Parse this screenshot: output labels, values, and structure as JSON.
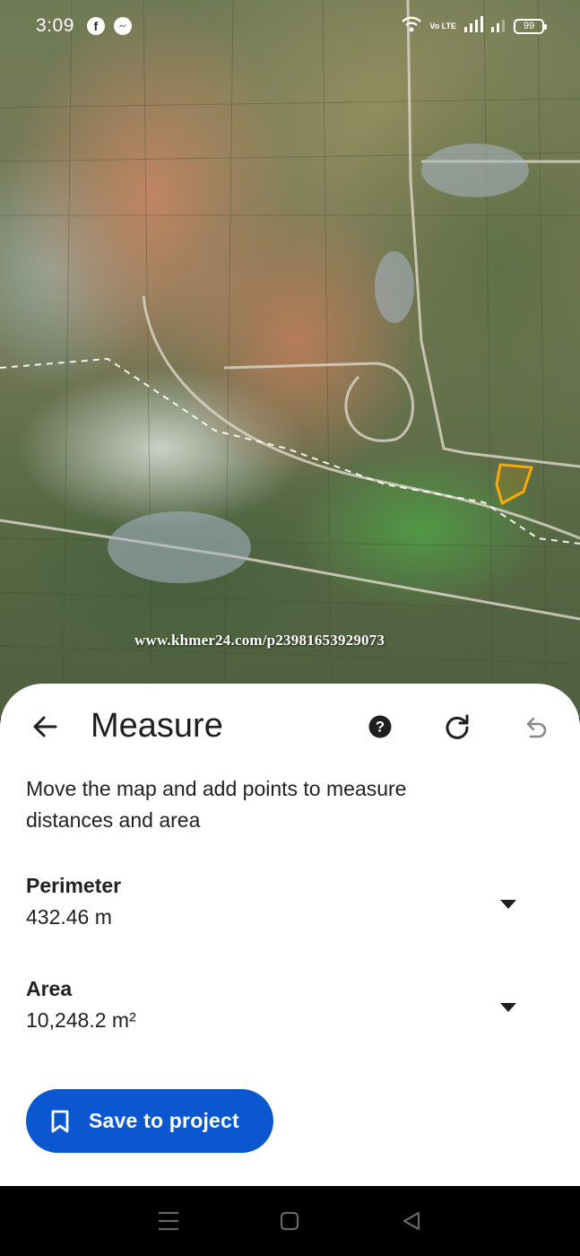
{
  "status_bar": {
    "time": "3:09",
    "battery": "99",
    "network": "Vo LTE",
    "icons": [
      "facebook-icon",
      "messenger-icon",
      "wifi-icon",
      "signal-icon",
      "signal-icon-2",
      "battery-icon"
    ]
  },
  "map": {
    "watermark": "www.khmer24.com/p23981653929073",
    "measured_shape_color": "#f9ab00"
  },
  "sheet": {
    "title": "Measure",
    "instructions": "Move the map and add points to measure distances and area",
    "perimeter": {
      "label": "Perimeter",
      "value": "432.46 m"
    },
    "area": {
      "label": "Area",
      "value": "10,248.2 m²"
    },
    "save_button": "Save to project",
    "icons": [
      "back-arrow-icon",
      "help-icon",
      "refresh-icon",
      "undo-icon",
      "dropdown-icon",
      "bookmark-icon"
    ]
  },
  "colors": {
    "accent": "#0b57d0",
    "sheet_bg": "#ffffff",
    "text": "#202124"
  },
  "nav_bar": {
    "icons": [
      "menu-icon",
      "home-icon",
      "back-icon"
    ]
  }
}
